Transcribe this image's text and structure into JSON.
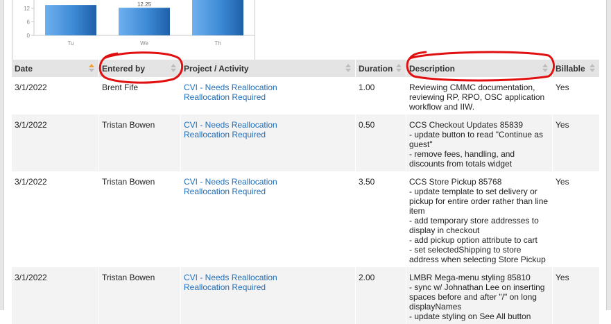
{
  "colors": {
    "bar": "#2f77c0",
    "link": "#1f6db8",
    "header_bg": "#e4e4e4",
    "annotation": "#e01010",
    "sort_active": "#f0a030"
  },
  "chart_data": {
    "type": "bar",
    "categories": [
      "Tu",
      "We",
      "Th"
    ],
    "values": [
      13.5,
      12.25,
      22
    ],
    "data_labels": [
      "",
      "12.25",
      ""
    ],
    "yticks": [
      "0",
      "6",
      "12"
    ],
    "ylim": [
      0,
      16
    ]
  },
  "table": {
    "headers": [
      {
        "label": "Date",
        "sort": "asc"
      },
      {
        "label": "Entered by",
        "sort": "none"
      },
      {
        "label": "Project / Activity",
        "sort": "none"
      },
      {
        "label": "Duration",
        "sort": "none"
      },
      {
        "label": "Description",
        "sort": "none"
      },
      {
        "label": "Billable",
        "sort": "none"
      }
    ],
    "rows": [
      {
        "date": "3/1/2022",
        "entered_by": "Brent Fife",
        "project_line1": "CVI - Needs Reallocation",
        "project_line2": "Reallocation Required",
        "duration": "1.00",
        "description": [
          "Reviewing CMMC documentation,",
          "reviewing RP, RPO, OSC application",
          "workflow and IIW."
        ],
        "billable": "Yes"
      },
      {
        "date": "3/1/2022",
        "entered_by": "Tristan Bowen",
        "project_line1": "CVI - Needs Reallocation",
        "project_line2": "Reallocation Required",
        "duration": "0.50",
        "description": [
          "CCS Checkout Updates 85839",
          "- update button to read \"Continue as",
          "guest\"",
          "- remove fees, handling, and",
          "discounts from totals widget"
        ],
        "billable": "Yes"
      },
      {
        "date": "3/1/2022",
        "entered_by": "Tristan Bowen",
        "project_line1": "CVI - Needs Reallocation",
        "project_line2": "Reallocation Required",
        "duration": "3.50",
        "description": [
          "CCS Store Pickup 85768",
          "- update template to set delivery or",
          "pickup for entire order rather than line",
          "item",
          "- add temporary store addresses to",
          "display in checkout",
          "- add pickup option attribute to cart",
          "- set selectedShipping to store",
          "address when selecting Store Pickup"
        ],
        "billable": "Yes"
      },
      {
        "date": "3/1/2022",
        "entered_by": "Tristan Bowen",
        "project_line1": "CVI - Needs Reallocation",
        "project_line2": "Reallocation Required",
        "duration": "2.00",
        "description": [
          "LMBR Mega-menu styling 85810",
          "- sync w/ Johnathan Lee on inserting",
          "spaces before and after \"/\" on long",
          "displayNames",
          "- update styling on See All button"
        ],
        "billable": "Yes"
      }
    ]
  }
}
